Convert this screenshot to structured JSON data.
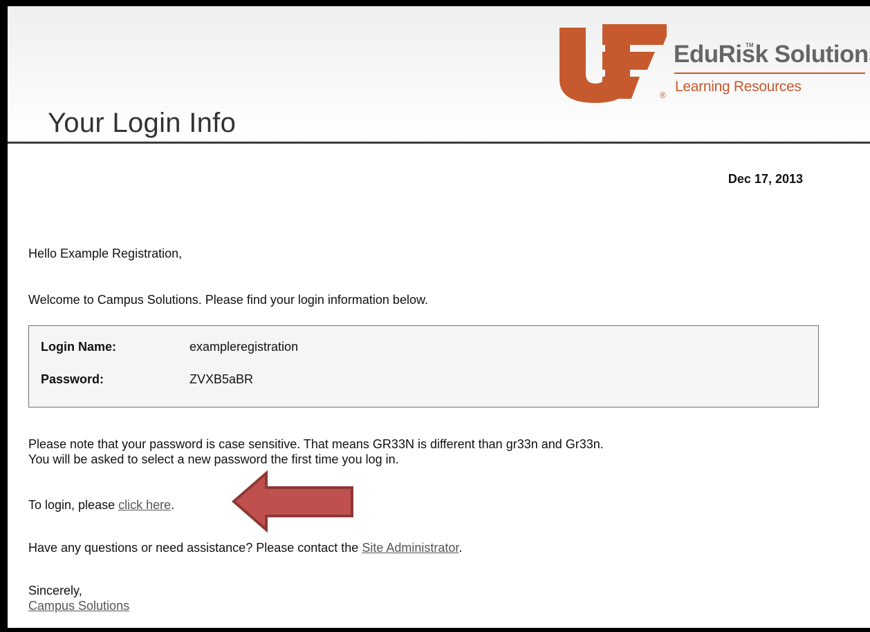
{
  "header": {
    "title": "Your Login Info",
    "logo": {
      "brand": "EduRisk Solutions",
      "trademark": "TM",
      "subtitle": "Learning Resources",
      "registered": "®",
      "mark_color": "#c65a2e"
    }
  },
  "email": {
    "date": "Dec 17, 2013",
    "greeting": "Hello Example Registration,",
    "welcome": "Welcome to Campus Solutions. Please find your login information below.",
    "credentials": {
      "login_label": "Login Name:",
      "login_value": "exampleregistration",
      "password_label": "Password:",
      "password_value": "ZVXB5aBR"
    },
    "note_line1": "Please note that your password is case sensitive. That means GR33N is different than gr33n and Gr33n.",
    "note_line2": "You will be asked to select a new password the first time you log in.",
    "login_prefix": "To login, please ",
    "login_link": "click here",
    "login_suffix": ".",
    "help_prefix": "Have any questions or need assistance? Please contact the ",
    "help_link": "Site Administrator",
    "help_suffix": ".",
    "closing": "Sincerely,",
    "signature_link": "Campus Solutions"
  },
  "annotation": {
    "arrow_icon": "left-arrow-icon",
    "arrow_fill": "#c0504d",
    "arrow_stroke": "#8c3836"
  }
}
